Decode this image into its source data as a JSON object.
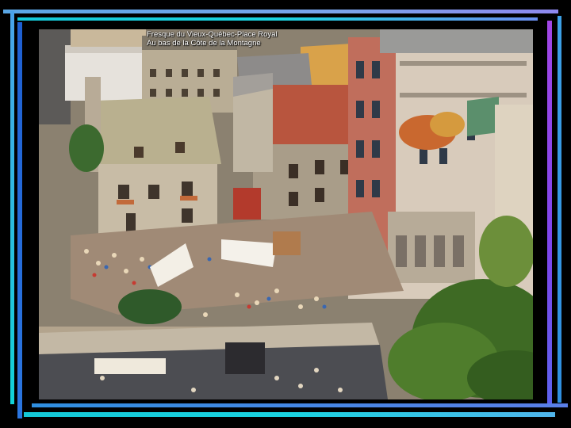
{
  "slide": {
    "caption_line_1": "Fresque du Vieux-Québec-Place Royal",
    "caption_line_2": "Au bas de la Côte de la Montagne"
  },
  "colors": {
    "background": "#000000",
    "frame_cyan": "#1ad3e0",
    "frame_blue": "#2b76e0",
    "frame_purple": "#7d46ec"
  },
  "photo": {
    "subject": "aerial view of old stone houses, a square with market tents and crowds, and a painted mural facade"
  }
}
